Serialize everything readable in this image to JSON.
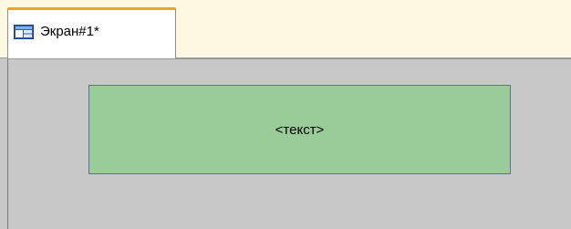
{
  "tab": {
    "label": "Экран#1*",
    "icon": "screen-icon",
    "accent_color": "#f2a12a"
  },
  "canvas": {
    "background_color": "#c8c8c8"
  },
  "text_element": {
    "label": "<текст>",
    "fill_color": "#99cc99",
    "border_color": "#5e6ea1"
  }
}
